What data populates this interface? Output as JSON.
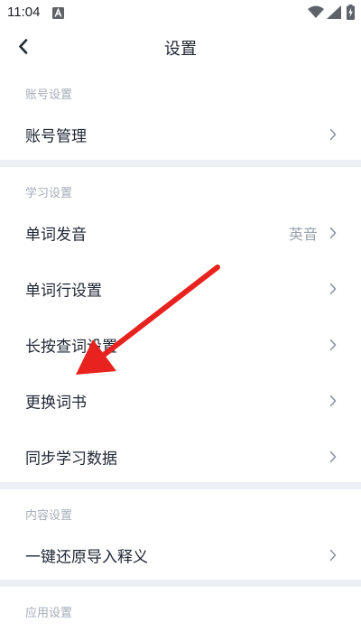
{
  "status_bar": {
    "time": "11:04",
    "icons": [
      "text-a-icon",
      "wifi-icon",
      "signal-icon",
      "battery-charging-icon"
    ]
  },
  "header": {
    "title": "设置",
    "back_icon": "chevron-left-icon"
  },
  "sections": {
    "account": {
      "title": "账号设置",
      "items": [
        {
          "label": "账号管理"
        }
      ]
    },
    "study": {
      "title": "学习设置",
      "items": [
        {
          "label": "单词发音",
          "value": "英音"
        },
        {
          "label": "单词行设置"
        },
        {
          "label": "长按查词设置"
        },
        {
          "label": "更换词书"
        },
        {
          "label": "同步学习数据"
        }
      ]
    },
    "content": {
      "title": "内容设置",
      "items": [
        {
          "label": "一键还原导入释义"
        }
      ]
    },
    "app": {
      "title": "应用设置"
    }
  },
  "annotation": {
    "type": "red-arrow",
    "color": "#e8231f",
    "points_to": "更换词书"
  },
  "colors": {
    "background": "#ffffff",
    "divider": "#ecf0f5",
    "primary_text": "#1f2633",
    "section_text": "#a7adb8",
    "value_text": "#9aa1ad"
  }
}
